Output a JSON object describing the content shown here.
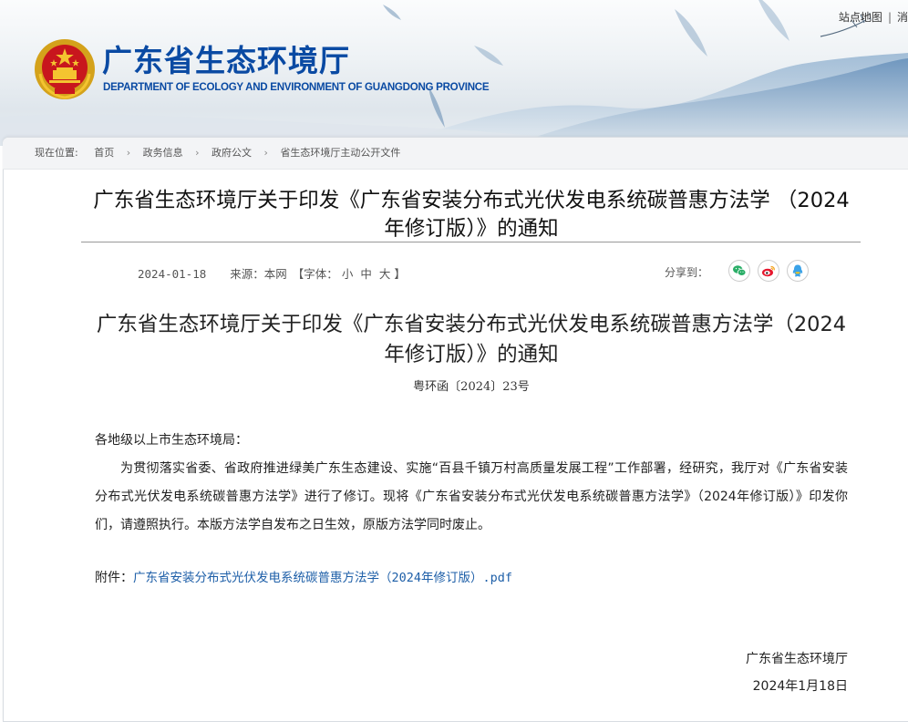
{
  "header": {
    "site_title": "广东省生态环境厅",
    "site_subtitle": "DEPARTMENT OF ECOLOGY AND ENVIRONMENT OF GUANGDONG PROVINCE",
    "top_links": [
      "站点地图",
      "|",
      "消"
    ]
  },
  "breadcrumb": {
    "label": "现在位置:",
    "items": [
      "首页",
      "政务信息",
      "政府公文",
      "省生态环境厅主动公开文件"
    ]
  },
  "article": {
    "title": "广东省生态环境厅关于印发《广东省安装分布式光伏发电系统碳普惠方法学 （2024年修订版）》的通知",
    "date": "2024-01-18",
    "source_label": "来源：",
    "source": "本网",
    "font_size_label": "【字体：",
    "font_sizes": [
      "小",
      "中",
      "大"
    ],
    "font_size_close": "】",
    "share_label": "分享到：",
    "share_targets": [
      "wechat-icon",
      "weibo-icon",
      "qq-icon"
    ]
  },
  "body": {
    "doc_title": "广东省生态环境厅关于印发《广东省安装分布式光伏发电系统碳普惠方法学（2024年修订版）》的通知",
    "doc_number": "粤环函〔2024〕23号",
    "salutation": "各地级以上市生态环境局：",
    "paragraph": "为贯彻落实省委、省政府推进绿美广东生态建设、实施“百县千镇万村高质量发展工程”工作部署，经研究，我厅对《广东省安装分布式光伏发电系统碳普惠方法学》进行了修订。现将《广东省安装分布式光伏发电系统碳普惠方法学》（2024年修订版）》印发你们，请遵照执行。本版方法学自发布之日生效，原版方法学同时废止。",
    "attachment_label": "附件：",
    "attachment_link": "广东省安装分布式光伏发电系统碳普惠方法学（2024年修订版）.pdf",
    "signature_org": "广东省生态环境厅",
    "signature_date": "2024年1月18日"
  },
  "colors": {
    "brand_blue": "#0a4aa3",
    "link_blue": "#1e5fa8",
    "wechat_green": "#2aae67",
    "weibo_red": "#e6162d",
    "qq_blue": "#3aa2e8"
  }
}
